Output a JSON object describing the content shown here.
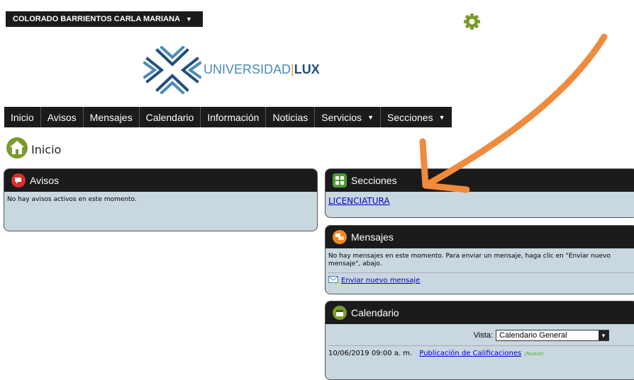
{
  "user": {
    "name": "COLORADO BARRIENTOS CARLA MARIANA"
  },
  "logo": {
    "universidad": "UNIVERSIDAD",
    "separator": "|",
    "lux": "LUX"
  },
  "nav": {
    "items": [
      {
        "label": "Inicio"
      },
      {
        "label": "Avisos"
      },
      {
        "label": "Mensajes"
      },
      {
        "label": "Calendario"
      },
      {
        "label": "Información"
      },
      {
        "label": "Noticias"
      },
      {
        "label": "Servicios",
        "dropdown": true
      },
      {
        "label": "Secciones",
        "dropdown": true
      }
    ]
  },
  "page": {
    "title": "Inicio"
  },
  "avisos": {
    "title": "Avisos",
    "message": "No hay avisos activos en este momento."
  },
  "secciones": {
    "title": "Secciones",
    "items": [
      "LICENCIATURA"
    ]
  },
  "mensajes": {
    "title": "Mensajes",
    "message": "No hay mensajes en este momento. Para enviar un mensaje, haga clic en \"Enviar nuevo mensaje\", abajo.",
    "send_link": "Enviar nuevo mensaje"
  },
  "calendario": {
    "title": "Calendario",
    "view_label": "Vista:",
    "view_value": "Calendario General",
    "events": [
      {
        "datetime": "10/06/2019 09:00 a. m.",
        "title": "Publicación de Calificaciones",
        "badge": "¡Nuevo!"
      }
    ]
  },
  "colors": {
    "accent_arrow": "#f08a3c",
    "panel_bg": "#c9d7df",
    "header_bg": "#1b1b1b"
  }
}
